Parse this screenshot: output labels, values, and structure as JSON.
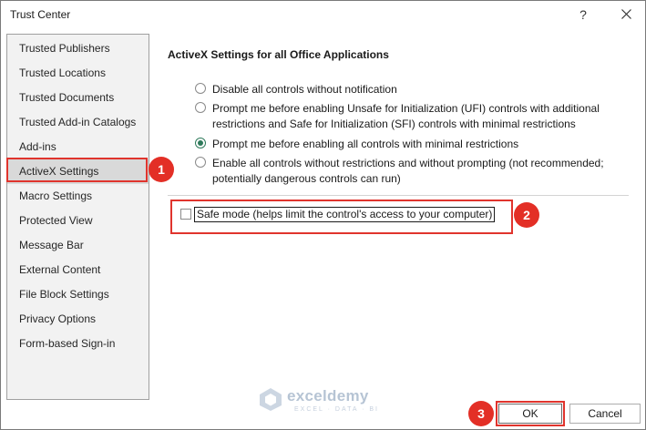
{
  "window": {
    "title": "Trust Center",
    "help_symbol": "?"
  },
  "sidebar": {
    "items": [
      {
        "label": "Trusted Publishers"
      },
      {
        "label": "Trusted Locations"
      },
      {
        "label": "Trusted Documents"
      },
      {
        "label": "Trusted Add-in Catalogs"
      },
      {
        "label": "Add-ins"
      },
      {
        "label": "ActiveX Settings",
        "selected": true
      },
      {
        "label": "Macro Settings"
      },
      {
        "label": "Protected View"
      },
      {
        "label": "Message Bar"
      },
      {
        "label": "External Content"
      },
      {
        "label": "File Block Settings"
      },
      {
        "label": "Privacy Options"
      },
      {
        "label": "Form-based Sign-in"
      }
    ]
  },
  "main": {
    "section_title": "ActiveX Settings for all Office Applications",
    "options": [
      {
        "label": "Disable all controls without notification",
        "checked": false
      },
      {
        "label": "Prompt me before enabling Unsafe for Initialization (UFI) controls with additional restrictions and Safe for Initialization (SFI) controls with minimal restrictions",
        "checked": false
      },
      {
        "label": "Prompt me before enabling all controls with minimal restrictions",
        "checked": true
      },
      {
        "label": "Enable all controls without restrictions and without prompting (not recommended; potentially dangerous controls can run)",
        "checked": false
      }
    ],
    "safe_mode": {
      "label": "Safe mode (helps limit the control's access to your computer)",
      "checked": false
    }
  },
  "footer": {
    "ok_label": "OK",
    "cancel_label": "Cancel"
  },
  "annotations": {
    "step1": "1",
    "step2": "2",
    "step3": "3"
  },
  "watermark": {
    "name": "exceldemy",
    "tagline": "EXCEL · DATA · BI"
  },
  "colors": {
    "highlight": "#e0342d",
    "badge": "#e32f26",
    "radio_checked": "#2f7a5b",
    "selected_bg": "#d9d9d9"
  }
}
